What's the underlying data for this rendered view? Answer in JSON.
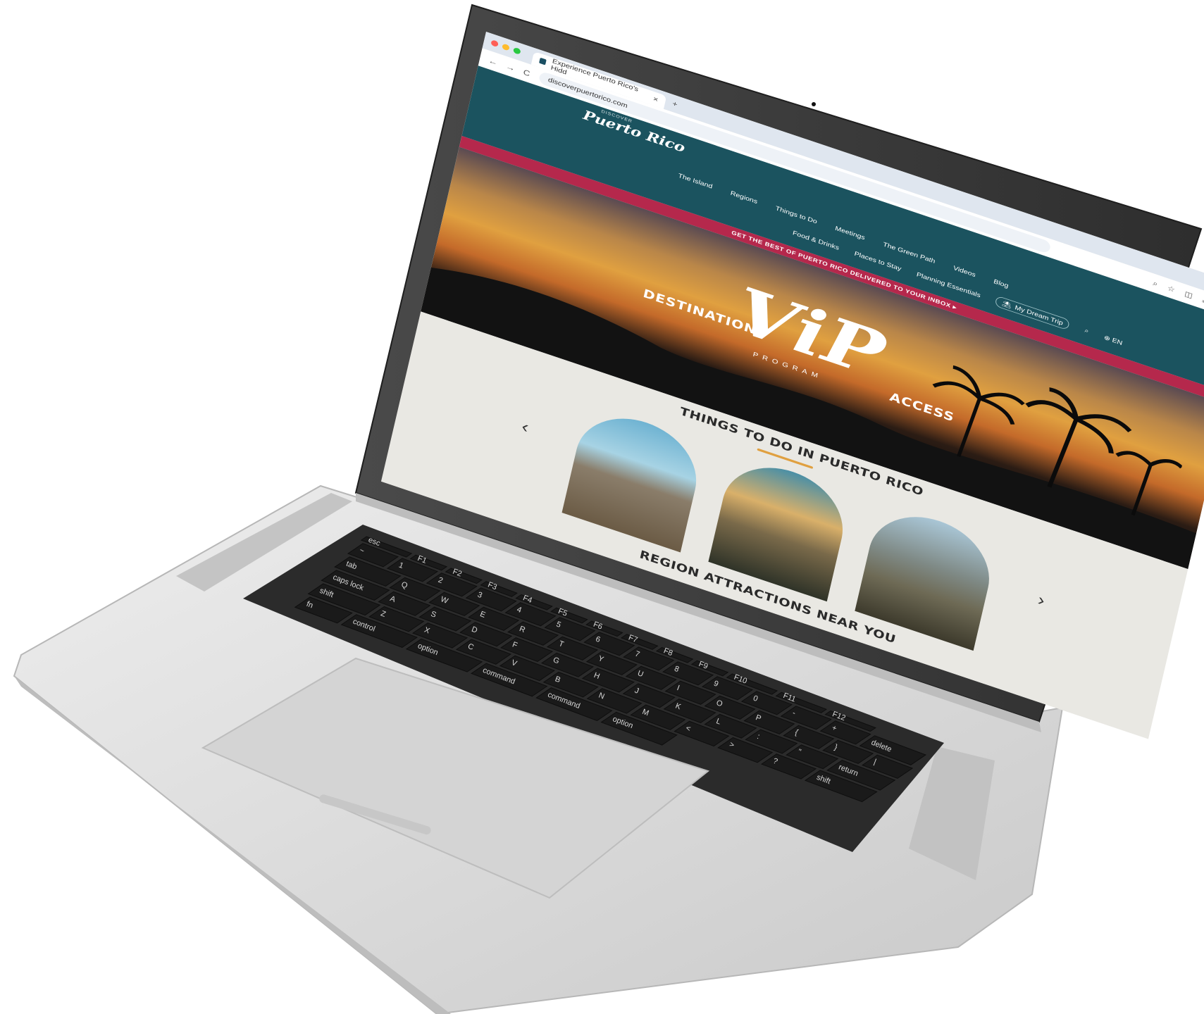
{
  "browser": {
    "tab_title": "Experience Puerto Rico's Hidd",
    "tab_close": "×",
    "new_tab": "+",
    "url": "discoverpuertorico.com",
    "nav_back": "←",
    "nav_forward": "→",
    "nav_reload": "C"
  },
  "site": {
    "logo_small": "DISCOVER",
    "logo": "Puerto Rico",
    "nav_primary": [
      "The Island",
      "Regions",
      "Things to Do",
      "Meetings",
      "The Green Path",
      "Videos",
      "Blog"
    ],
    "nav_secondary": [
      "Food & Drinks",
      "Places to Stay",
      "Planning Essentials"
    ],
    "dream_trip": "My Dream Trip",
    "language": "EN",
    "promo": "GET THE BEST OF PUERTO RICO DELIVERED TO YOUR INBOX ▸",
    "hero": {
      "destination": "DESTINATION",
      "vip": "ViP",
      "program": "PROGRAM",
      "access": "ACCESS"
    },
    "things_title": "THINGS TO DO IN PUERTO RICO",
    "region_title": "REGION ATTRACTIONS NEAR YOU",
    "prev_arrow": "‹",
    "next_arrow": "›"
  },
  "keyboard": {
    "row_fn": [
      "esc",
      "F1",
      "F2",
      "F3",
      "F4",
      "F5",
      "F6",
      "F7",
      "F8",
      "F9",
      "F10",
      "F11",
      "F12"
    ],
    "row_num": [
      "~",
      "1",
      "2",
      "3",
      "4",
      "5",
      "6",
      "7",
      "8",
      "9",
      "0",
      "-",
      "+",
      "delete"
    ],
    "row_q": [
      "tab",
      "Q",
      "W",
      "E",
      "R",
      "T",
      "Y",
      "U",
      "I",
      "O",
      "P",
      "{",
      "}",
      "|"
    ],
    "row_a": [
      "caps lock",
      "A",
      "S",
      "D",
      "F",
      "G",
      "H",
      "J",
      "K",
      "L",
      ":",
      "\"",
      "return"
    ],
    "row_z": [
      "shift",
      "Z",
      "X",
      "C",
      "V",
      "B",
      "N",
      "M",
      "<",
      ">",
      "?",
      "shift"
    ],
    "row_bottom": [
      "fn",
      "control",
      "option",
      "command",
      "command",
      "option"
    ]
  },
  "colors": {
    "header_teal": "#1b535f",
    "promo_red": "#b5284c",
    "page_bg": "#e9e8e3",
    "accent_gold": "#e0a040",
    "laptop_silver": "#d9d9d9",
    "bezel": "#3a3a3a"
  }
}
